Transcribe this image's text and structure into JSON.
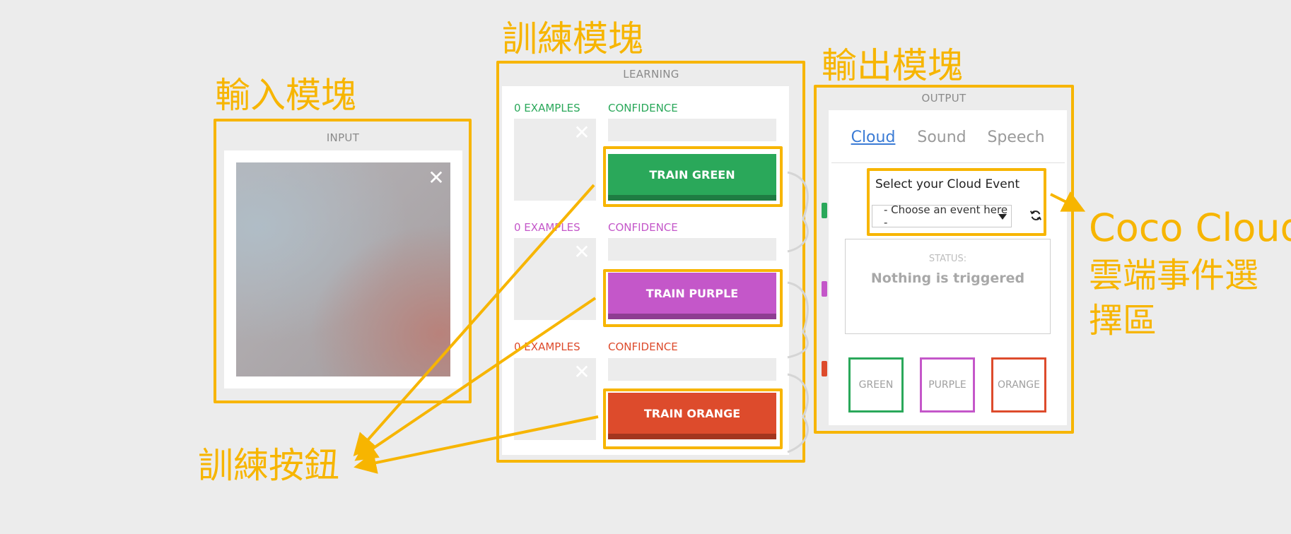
{
  "annotations": {
    "input_title": "輸入模塊",
    "learning_title": "訓練模塊",
    "output_title": "輸出模塊",
    "train_buttons_label": "訓練按鈕",
    "coco_cloud_line1": "Coco Cloud",
    "coco_cloud_line2": "雲端事件選",
    "coco_cloud_line3": "擇區",
    "color": "#f7b500"
  },
  "input": {
    "header": "INPUT",
    "close_icon": "✕"
  },
  "learning": {
    "header": "LEARNING",
    "classes": [
      {
        "examples": "0 EXAMPLES",
        "confidence": "CONFIDENCE",
        "button": "TRAIN GREEN",
        "color": "#2aa85a",
        "close_icon": "✕"
      },
      {
        "examples": "0 EXAMPLES",
        "confidence": "CONFIDENCE",
        "button": "TRAIN PURPLE",
        "color": "#c457c9",
        "close_icon": "✕"
      },
      {
        "examples": "0 EXAMPLES",
        "confidence": "CONFIDENCE",
        "button": "TRAIN ORANGE",
        "color": "#dd4b2c",
        "close_icon": "✕"
      }
    ]
  },
  "output": {
    "header": "OUTPUT",
    "tabs": [
      {
        "label": "Cloud",
        "active": true
      },
      {
        "label": "Sound",
        "active": false
      },
      {
        "label": "Speech",
        "active": false
      }
    ],
    "cloud_event_title": "Select your Cloud Event",
    "select_value": "- Choose an event here -",
    "refresh_icon": "refresh-icon",
    "status_label": "STATUS:",
    "status_text": "Nothing is triggered",
    "outputs": [
      {
        "label": "GREEN",
        "color": "#2aa85a"
      },
      {
        "label": "PURPLE",
        "color": "#c457c9"
      },
      {
        "label": "ORANGE",
        "color": "#dd4b2c"
      }
    ]
  }
}
